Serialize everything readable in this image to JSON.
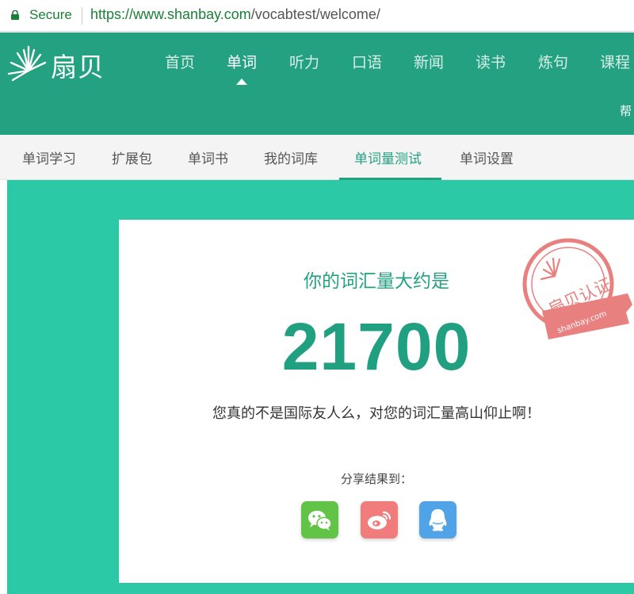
{
  "address_bar": {
    "secure_label": "Secure",
    "url_host": "https://www.shanbay.com",
    "url_path": "/vocabtest/welcome/"
  },
  "header": {
    "logo_text": "扇贝",
    "nav": [
      {
        "label": "首页"
      },
      {
        "label": "单词",
        "active": true
      },
      {
        "label": "听力"
      },
      {
        "label": "口语"
      },
      {
        "label": "新闻"
      },
      {
        "label": "读书"
      },
      {
        "label": "炼句"
      },
      {
        "label": "课程"
      }
    ],
    "help_label": "帮"
  },
  "subnav": [
    {
      "label": "单词学习"
    },
    {
      "label": "扩展包"
    },
    {
      "label": "单词书"
    },
    {
      "label": "我的词库"
    },
    {
      "label": "单词量测试",
      "active": true
    },
    {
      "label": "单词设置"
    }
  ],
  "result": {
    "title": "你的词汇量大约是",
    "vocab_size": "21700",
    "comment": "您真的不是国际友人么，对您的词汇量高山仰止啊！",
    "share_label": "分享结果到：",
    "stamp_main": "扇贝认证",
    "stamp_url": "shanbay.com"
  },
  "share": [
    {
      "icon": "wechat-icon"
    },
    {
      "icon": "weibo-icon"
    },
    {
      "icon": "qq-icon"
    }
  ],
  "colors": {
    "brand_green": "#23a181",
    "stage_teal": "#2cc9a6",
    "stamp_red": "#e88080",
    "secure_green": "#1a7f37"
  }
}
